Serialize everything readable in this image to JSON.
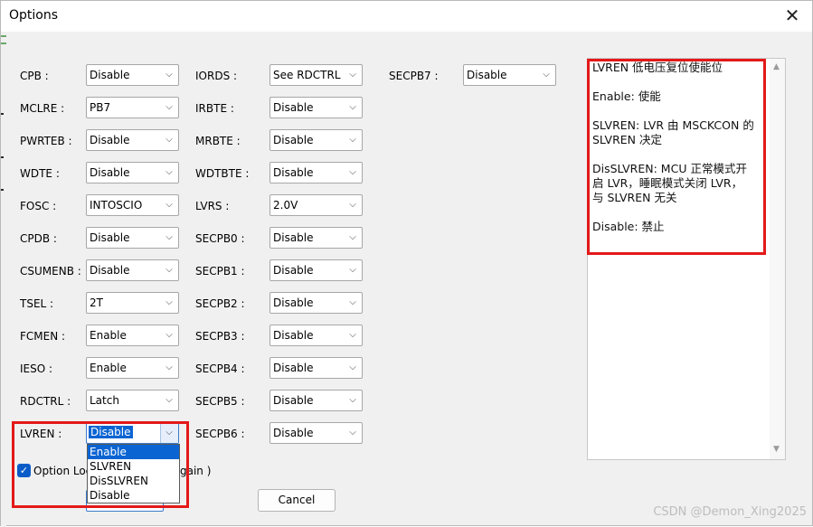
{
  "window": {
    "title": "Options",
    "close_glyph": "✕"
  },
  "column1": [
    {
      "label": "CPB :",
      "value": "Disable"
    },
    {
      "label": "MCLRE :",
      "value": "PB7"
    },
    {
      "label": "PWRTEB :",
      "value": "Disable"
    },
    {
      "label": "WDTE :",
      "value": "Disable"
    },
    {
      "label": "FOSC :",
      "value": "INTOSCIO"
    },
    {
      "label": "CPDB :",
      "value": "Disable"
    },
    {
      "label": "CSUMENB :",
      "value": "Disable"
    },
    {
      "label": "TSEL :",
      "value": "2T"
    },
    {
      "label": "FCMEN :",
      "value": "Enable"
    },
    {
      "label": "IESO :",
      "value": "Enable"
    },
    {
      "label": "RDCTRL :",
      "value": "Latch"
    },
    {
      "label": "LVREN :",
      "value": "Disable"
    }
  ],
  "column2": [
    {
      "label": "IORDS :",
      "value": "See RDCTRL"
    },
    {
      "label": "IRBTE :",
      "value": "Disable"
    },
    {
      "label": "MRBTE :",
      "value": "Disable"
    },
    {
      "label": "WDTBTE :",
      "value": "Disable"
    },
    {
      "label": "LVRS :",
      "value": "2.0V"
    },
    {
      "label": "SECPB0 :",
      "value": "Disable"
    },
    {
      "label": "SECPB1 :",
      "value": "Disable"
    },
    {
      "label": "SECPB2 :",
      "value": "Disable"
    },
    {
      "label": "SECPB3 :",
      "value": "Disable"
    },
    {
      "label": "SECPB4 :",
      "value": "Disable"
    },
    {
      "label": "SECPB5 :",
      "value": "Disable"
    },
    {
      "label": "SECPB6 :",
      "value": "Disable"
    }
  ],
  "column3": [
    {
      "label": "SECPB7 :",
      "value": "Disable"
    }
  ],
  "lvren_dropdown": {
    "options": [
      "Enable",
      "SLVREN",
      "DisSLVREN",
      "Disable"
    ],
    "highlighted_index": 0
  },
  "option_lock": {
    "checked": true,
    "label_start": "Option Loc",
    "label_end": "gain )"
  },
  "buttons": {
    "cancel": "Cancel"
  },
  "help_panel": {
    "text": "LVREN 低电压复位使能位\n\nEnable: 使能\n\nSLVREN: LVR 由 MSCKCON 的\nSLVREN 决定\n\nDisSLVREN: MCU 正常模式开\n启 LVR，睡眠模式关闭 LVR，\n与 SLVREN 无关\n\nDisable: 禁止"
  },
  "watermark": "CSDN @Demon_Xing2025",
  "colors": {
    "highlight": "#e31919",
    "selection": "#0a64d2"
  }
}
